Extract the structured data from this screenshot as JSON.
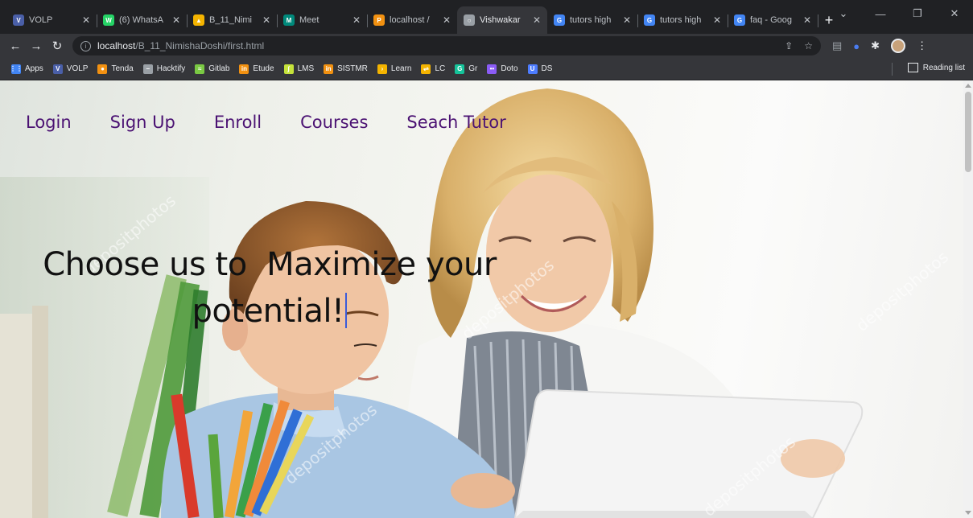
{
  "browser": {
    "tabs": [
      {
        "title": "VOLP",
        "favicon": "volp-icon",
        "color": "#4a5fa8",
        "glyph": "V"
      },
      {
        "title": "(6) WhatsA",
        "favicon": "whatsapp-icon",
        "color": "#25d366",
        "glyph": "W"
      },
      {
        "title": "B_11_Nimi",
        "favicon": "drive-icon",
        "color": "#f4b400",
        "glyph": "▲"
      },
      {
        "title": "Meet",
        "favicon": "meet-icon",
        "color": "#00897b",
        "glyph": "M"
      },
      {
        "title": "localhost /",
        "favicon": "phpmyadmin-icon",
        "color": "#f29111",
        "glyph": "P"
      },
      {
        "title": "Vishwakar",
        "favicon": "globe-icon",
        "color": "#9aa0a6",
        "glyph": "○"
      },
      {
        "title": "tutors high",
        "favicon": "google-icon",
        "color": "#4285f4",
        "glyph": "G"
      },
      {
        "title": "tutors high",
        "favicon": "google-icon",
        "color": "#4285f4",
        "glyph": "G"
      },
      {
        "title": "faq - Goog",
        "favicon": "google-icon",
        "color": "#4285f4",
        "glyph": "G"
      }
    ],
    "active_tab_index": 5,
    "url_host": "localhost",
    "url_path": "/B_11_NimishaDoshi/first.html",
    "bookmarks": [
      {
        "label": "Apps",
        "icon": "apps-grid-icon",
        "color": "#4285f4",
        "glyph": "⋮⋮"
      },
      {
        "label": "VOLP",
        "icon": "volp-icon",
        "color": "#4a5fa8",
        "glyph": "V"
      },
      {
        "label": "Tenda",
        "icon": "tenda-icon",
        "color": "#f29111",
        "glyph": "●"
      },
      {
        "label": "Hacktify",
        "icon": "hacktify-icon",
        "color": "#9aa0a6",
        "glyph": "−"
      },
      {
        "label": "Gitlab",
        "icon": "gitlab-icon",
        "color": "#7ac943",
        "glyph": "≈"
      },
      {
        "label": "Etude",
        "icon": "etude-icon",
        "color": "#f29111",
        "glyph": "in"
      },
      {
        "label": "LMS",
        "icon": "lms-icon",
        "color": "#c5e23a",
        "glyph": "∫"
      },
      {
        "label": "SISTMR",
        "icon": "sistmr-icon",
        "color": "#f29111",
        "glyph": "in"
      },
      {
        "label": "Learn",
        "icon": "learn-icon",
        "color": "#f4b400",
        "glyph": "›"
      },
      {
        "label": "LC",
        "icon": "leetcode-icon",
        "color": "#f4b400",
        "glyph": "⇌"
      },
      {
        "label": "Gr",
        "icon": "grammarly-icon",
        "color": "#15c39a",
        "glyph": "G"
      },
      {
        "label": "Doto",
        "icon": "doto-icon",
        "color": "#8b5cf6",
        "glyph": "••"
      },
      {
        "label": "DS",
        "icon": "ds-icon",
        "color": "#4d7cfe",
        "glyph": "U"
      }
    ],
    "reading_list": "Reading list"
  },
  "page": {
    "nav": [
      "Login",
      "Sign Up",
      "Enroll",
      "Courses",
      "Seach Tutor"
    ],
    "headline": "Choose us to  Maximize your potential!",
    "watermark": "depositphotos"
  }
}
